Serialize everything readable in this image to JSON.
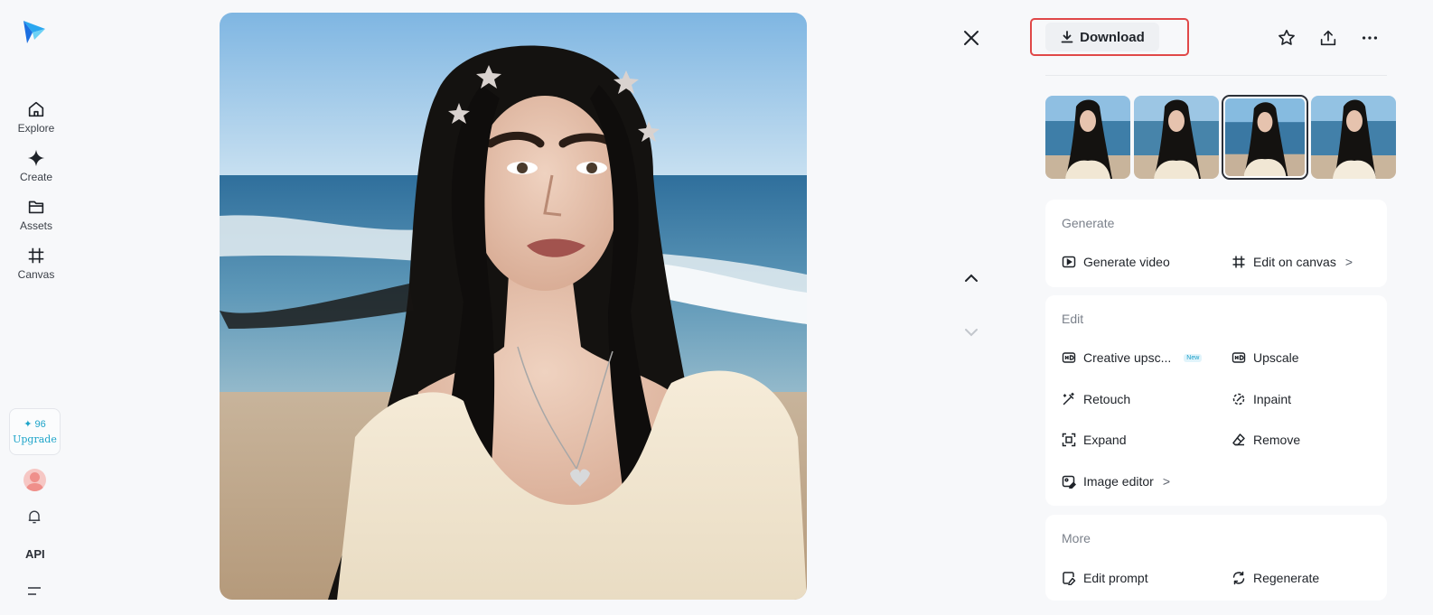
{
  "sidebar": {
    "nav": [
      {
        "label": "Explore",
        "icon": "home-icon"
      },
      {
        "label": "Create",
        "icon": "sparkle-icon"
      },
      {
        "label": "Assets",
        "icon": "folder-icon"
      },
      {
        "label": "Canvas",
        "icon": "canvas-crop-icon"
      }
    ],
    "credits": {
      "amount": "✦ 96",
      "upgrade_label": "Upgrade"
    },
    "api_label": "API"
  },
  "toolbar": {
    "download_label": "Download"
  },
  "panel": {
    "generate": {
      "title": "Generate",
      "actions": [
        {
          "label": "Generate video",
          "icon": "play-square-icon"
        },
        {
          "label": "Edit on canvas",
          "icon": "canvas-crop-icon",
          "chevron": ">"
        }
      ]
    },
    "edit": {
      "title": "Edit",
      "actions": [
        {
          "label": "Creative upsc...",
          "icon": "hd-sparkle-icon",
          "badge": "New"
        },
        {
          "label": "Upscale",
          "icon": "hd-icon"
        },
        {
          "label": "Retouch",
          "icon": "magic-wand-icon"
        },
        {
          "label": "Inpaint",
          "icon": "inpaint-icon"
        },
        {
          "label": "Expand",
          "icon": "expand-icon"
        },
        {
          "label": "Remove",
          "icon": "eraser-icon"
        },
        {
          "label": "Image editor",
          "icon": "image-edit-icon",
          "chevron": ">"
        }
      ]
    },
    "more": {
      "title": "More",
      "actions": [
        {
          "label": "Edit prompt",
          "icon": "edit-prompt-icon"
        },
        {
          "label": "Regenerate",
          "icon": "regenerate-icon"
        }
      ]
    }
  },
  "thumbnails": {
    "count": 4,
    "selected_index": 2
  },
  "colors": {
    "accent": "#1da4c9",
    "highlight": "#e04848"
  }
}
